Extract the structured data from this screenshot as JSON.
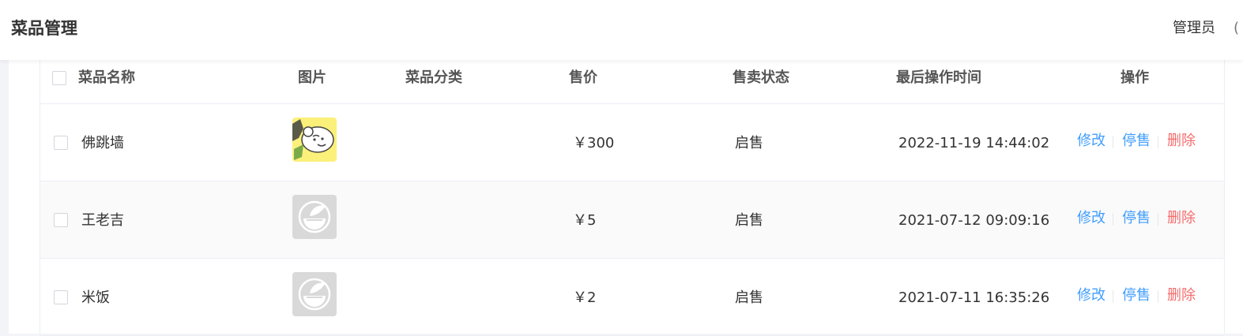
{
  "header": {
    "title": "菜品管理",
    "user": "管理员",
    "user_icon": "("
  },
  "table": {
    "columns": [
      "菜品名称",
      "图片",
      "菜品分类",
      "售价",
      "售卖状态",
      "最后操作时间",
      "操作"
    ],
    "rows": [
      {
        "name": "佛跳墙",
        "image": "dish-photo",
        "category": "",
        "price": "￥300",
        "status": "启售",
        "time": "2022-11-19 14:44:02"
      },
      {
        "name": "王老吉",
        "image": "placeholder-dish-icon",
        "category": "",
        "price": "￥5",
        "status": "启售",
        "time": "2021-07-12 09:09:16"
      },
      {
        "name": "米饭",
        "image": "placeholder-dish-icon",
        "category": "",
        "price": "￥2",
        "status": "启售",
        "time": "2021-07-11 16:35:26"
      }
    ],
    "actions": {
      "edit": "修改",
      "disable": "停售",
      "delete": "删除"
    }
  },
  "colors": {
    "link": "#419eff",
    "danger": "#f56c6c",
    "header_text": "#555555"
  }
}
